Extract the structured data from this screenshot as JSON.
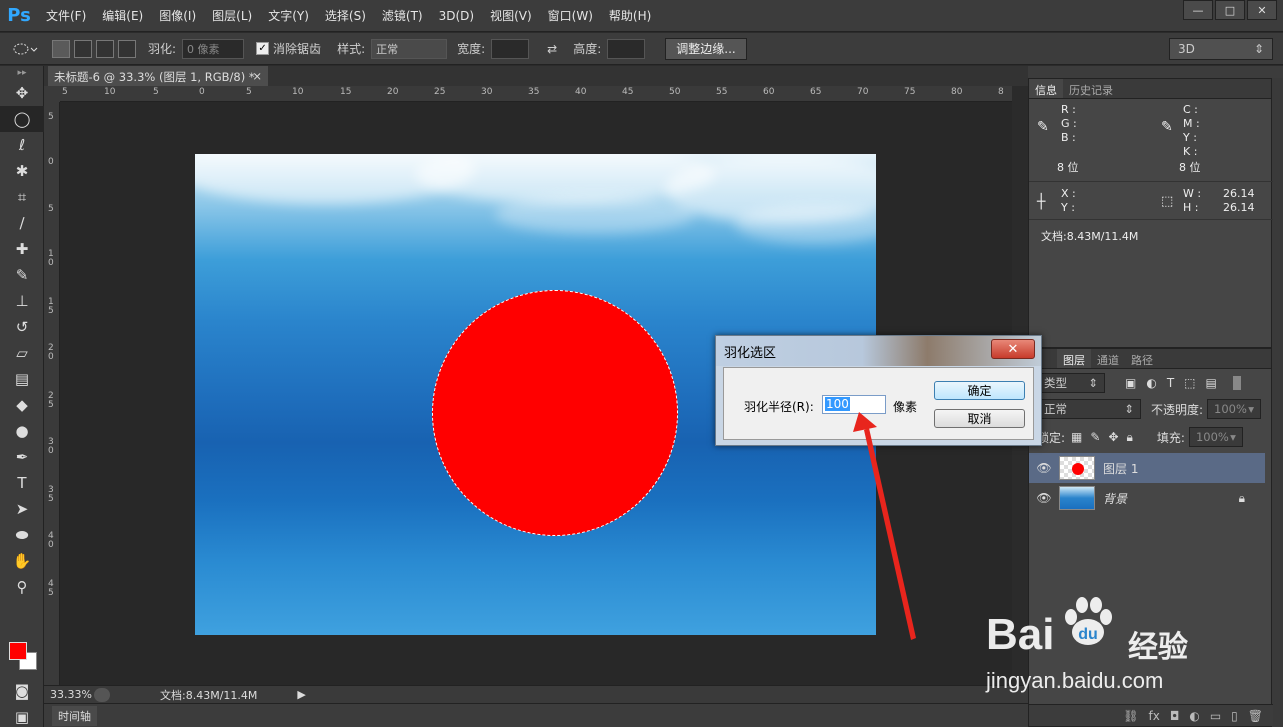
{
  "app": {
    "logo": "Ps",
    "menu": [
      "文件(F)",
      "编辑(E)",
      "图像(I)",
      "图层(L)",
      "文字(Y)",
      "选择(S)",
      "滤镜(T)",
      "3D(D)",
      "视图(V)",
      "窗口(W)",
      "帮助(H)"
    ],
    "window_buttons": [
      "—",
      "□",
      "✕"
    ]
  },
  "options": {
    "feather_label": "羽化:",
    "feather_value": "0 像素",
    "antialias_label": "消除锯齿",
    "style_label": "样式:",
    "style_value": "正常",
    "width_label": "宽度:",
    "height_label": "高度:",
    "refine_edge_button": "调整边缘...",
    "workspace": "3D"
  },
  "document": {
    "tab_title": "未标题-6 @ 33.3% (图层 1, RGB/8) *",
    "ruler_h_labels": [
      "5",
      "10",
      "5",
      "0",
      "5",
      "10",
      "15",
      "20",
      "25",
      "30",
      "35",
      "40",
      "45",
      "50",
      "55",
      "60",
      "65",
      "70",
      "75",
      "80",
      "8"
    ],
    "ruler_v_labels": [
      "5",
      "0",
      "5",
      "1\n0",
      "1\n5",
      "2\n0",
      "2\n5",
      "3\n0",
      "3\n5",
      "4\n0",
      "4\n5"
    ]
  },
  "status": {
    "zoom": "33.33%",
    "doc_size": "文档:8.43M/11.4M",
    "timeline_label": "时间轴"
  },
  "info_panel": {
    "tabs": [
      "信息",
      "历史记录"
    ],
    "rgb_labels": [
      "R :",
      "G :",
      "B :"
    ],
    "cmyk_labels": [
      "C :",
      "M :",
      "Y :",
      "K :"
    ],
    "bit_left": "8 位",
    "bit_right": "8 位",
    "xy_labels": [
      "X :",
      "Y :"
    ],
    "w_label": "W :",
    "h_label": "H :",
    "w_value": "26.14",
    "h_value": "26.14",
    "doc_info": "文档:8.43M/11.4M"
  },
  "layers_panel": {
    "tabs": [
      "图层",
      "通道",
      "路径"
    ],
    "filter_label": "类型",
    "blend_mode": "正常",
    "opacity_label": "不透明度:",
    "opacity_value": "100%",
    "lock_label": "锁定:",
    "fill_label": "填充:",
    "fill_value": "100%",
    "layers": [
      {
        "name": "图层 1",
        "selected": true
      },
      {
        "name": "背景",
        "selected": false,
        "locked": true
      }
    ]
  },
  "dialog": {
    "title": "羽化选区",
    "radius_label": "羽化半径(R):",
    "radius_value": "100",
    "unit": "像素",
    "ok_button": "确定",
    "cancel_button": "取消"
  },
  "watermark": {
    "brand": "Bai",
    "brand_suffix": "经验",
    "url": "jingyan.baidu.com"
  },
  "colors": {
    "foreground": "#ff0000",
    "background": "#ffffff",
    "accent": "#31a8ff"
  }
}
